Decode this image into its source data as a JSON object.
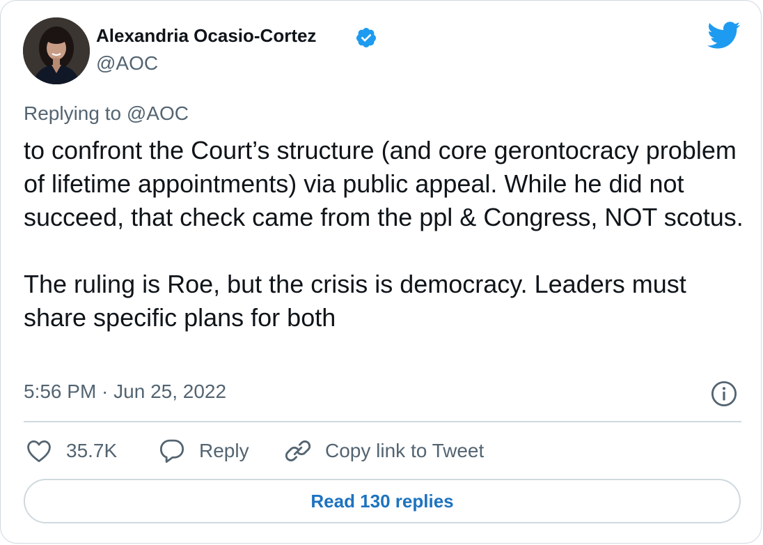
{
  "author": {
    "name": "Alexandria Ocasio-Cortez",
    "handle": "@AOC",
    "verified": true,
    "avatar": "profile-photo"
  },
  "brand_icon": "twitter-bird-icon",
  "replying_to": "Replying to @AOC",
  "tweet": {
    "paragraphs": [
      "to confront the Court’s structure (and core gerontocracy problem of lifetime appointments) via public appeal. While he did not succeed, that check came from the ppl & Congress, NOT scotus.",
      "The ruling is Roe, but the crisis is democracy. Leaders must share specific plans for both"
    ],
    "timestamp": "5:56 PM · Jun 25, 2022"
  },
  "actions": {
    "like_count": "35.7K",
    "reply_label": "Reply",
    "copy_link_label": "Copy link to Tweet"
  },
  "read_replies_label": "Read 130 replies",
  "colors": {
    "brand_blue": "#1d9bf0",
    "link_blue": "#1d73bf",
    "secondary_text": "#536471",
    "border": "#cfd9de"
  }
}
